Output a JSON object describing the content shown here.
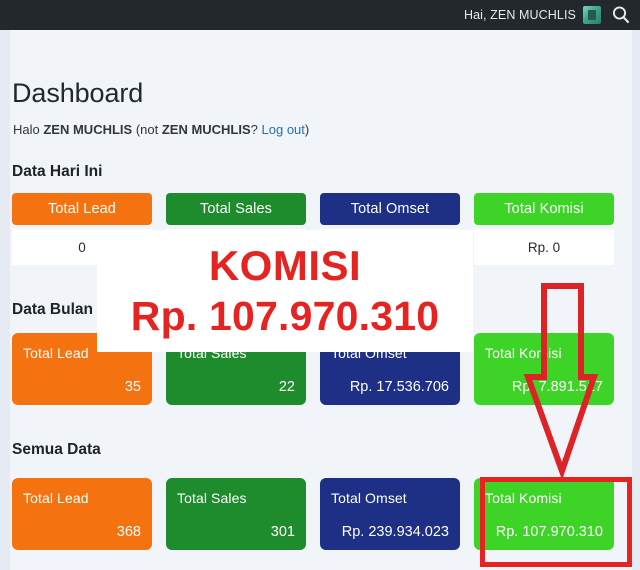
{
  "adminbar": {
    "greeting": "Hai, ZEN MUCHLIS",
    "avatar_icon": "user-avatar-thumbnail",
    "search_icon": "search-icon"
  },
  "page": {
    "title": "Dashboard",
    "greeting_prefix": "Halo ",
    "user_name": "ZEN MUCHLIS",
    "greeting_middle": " (not ",
    "user_name_2": "ZEN MUCHLIS",
    "greeting_question": "? ",
    "logout_label": "Log out",
    "greeting_suffix": ")"
  },
  "sections": {
    "today": "Data Hari Ini",
    "month": "Data Bulan",
    "all": "Semua Data"
  },
  "colors": {
    "orange": "#F4720F",
    "green": "#1E8B2D",
    "blue": "#1E2F86",
    "bright_green": "#3ED327",
    "red_accent": "#E52421",
    "admin_bar": "#23282D",
    "page_bg": "#F1F4F9"
  },
  "today_cards": [
    {
      "label": "Total Lead",
      "value": "0",
      "color_key": "orange"
    },
    {
      "label": "Total Sales",
      "value": "",
      "color_key": "green"
    },
    {
      "label": "Total Omset",
      "value": "",
      "color_key": "blue"
    },
    {
      "label": "Total Komisi",
      "value": "Rp. 0",
      "color_key": "bright_green"
    }
  ],
  "month_cards": [
    {
      "label": "Total Lead",
      "value": "35",
      "color_key": "orange"
    },
    {
      "label": "Total Sales",
      "value": "22",
      "color_key": "green"
    },
    {
      "label": "Total Omset",
      "value": "Rp. 17.536.706",
      "color_key": "blue"
    },
    {
      "label": "Total Komisi",
      "value": "Rp. 7.891.517",
      "color_key": "bright_green"
    }
  ],
  "all_cards": [
    {
      "label": "Total Lead",
      "value": "368",
      "color_key": "orange"
    },
    {
      "label": "Total Sales",
      "value": "301",
      "color_key": "green"
    },
    {
      "label": "Total Omset",
      "value": "Rp. 239.934.023",
      "color_key": "blue"
    },
    {
      "label": "Total Komisi",
      "value": "Rp. 107.970.310",
      "color_key": "bright_green"
    }
  ],
  "overlay": {
    "heading": "KOMISI",
    "amount": "Rp. 107.970.310"
  },
  "annotations": {
    "arrow_icon": "red-down-arrow-annotation",
    "highlight_target": "Total Komisi"
  }
}
